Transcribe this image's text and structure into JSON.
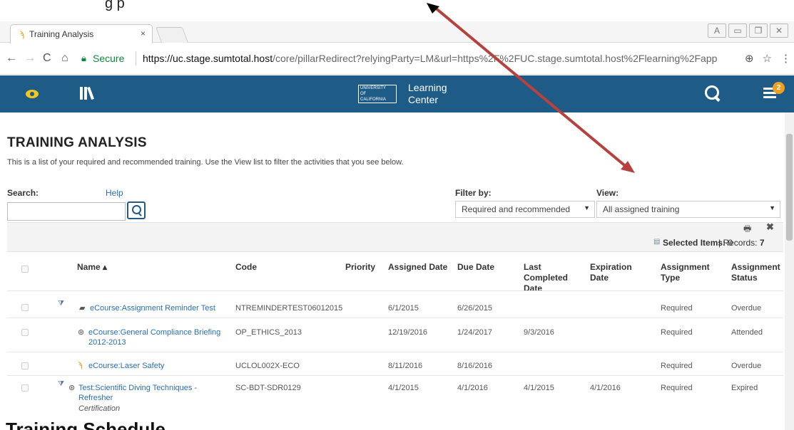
{
  "caption": {
    "text": "g                                                                                             p"
  },
  "browser": {
    "tab_title": "Training Analysis",
    "tab_close": "×",
    "secure_label": "Secure",
    "url_host": "https://uc.stage.sumtotal.host",
    "url_path": "/core/pillarRedirect?relyingParty=LM&url=https%2F%2FUC.stage.sumtotal.host%2Flearning%2Fapp"
  },
  "header": {
    "logo_line1": "UNIVERSITY",
    "logo_line2": "OF",
    "logo_line3": "CALIFORNIA",
    "logo_title1": "Learning",
    "logo_title2": "Center",
    "notification_count": "2"
  },
  "page": {
    "title": "TRAINING ANALYSIS",
    "intro": "This is a list of your required and recommended training. Use the View list to filter the activities that you see below.",
    "search_label": "Search:",
    "help_label": "Help",
    "search_value": "",
    "filter_label": "Filter by:",
    "filter_value": "Required and recommended",
    "view_label": "View:",
    "view_value": "All assigned training",
    "selected_label": "Selected Items:",
    "selected_count": "0",
    "records_label": "| Records:",
    "records_count": "7"
  },
  "table": {
    "headers": {
      "name": "Name ▴",
      "code": "Code",
      "priority": "Priority",
      "assigned": "Assigned Date",
      "due": "Due Date",
      "last_completed": "Last Completed Date",
      "expiration": "Expiration Date",
      "assignment_type": "Assignment Type",
      "assignment_status": "Assignment Status"
    },
    "rows": [
      {
        "name": "eCourse:Assignment Reminder Test",
        "code": "NTREMINDERTEST06012015",
        "assigned": "6/1/2015",
        "due": "6/26/2015",
        "last_completed": "",
        "expiration": "",
        "type": "Required",
        "status": "Overdue"
      },
      {
        "name": "eCourse:General Compliance Briefing 2012-2013",
        "code": "OP_ETHICS_2013",
        "assigned": "12/19/2016",
        "due": "1/24/2017",
        "last_completed": "9/3/2016",
        "expiration": "",
        "type": "Required",
        "status": "Attended"
      },
      {
        "name": "eCourse:Laser Safety",
        "code": "UCLOL002X-ECO",
        "assigned": "8/11/2016",
        "due": "8/16/2016",
        "last_completed": "",
        "expiration": "",
        "type": "Required",
        "status": "Overdue"
      },
      {
        "name": "Test:Scientific Diving Techniques - Refresher",
        "sub": "Certification",
        "code": "SC-BDT-SDR0129",
        "assigned": "4/1/2015",
        "due": "4/1/2016",
        "last_completed": "4/1/2015",
        "expiration": "4/1/2016",
        "type": "Required",
        "status": "Expired"
      }
    ]
  },
  "footer": {
    "heading": "Training Schedule"
  },
  "colors": {
    "header_bg": "#1e5b86",
    "link": "#2a6fb0",
    "arrow": "#b5423e",
    "badge": "#f0a020"
  },
  "icons": [
    "eye-icon",
    "books-icon",
    "search-icon",
    "list-icon",
    "print-icon",
    "close-icon",
    "flag-icon",
    "course-icon",
    "globe-icon",
    "laser-icon"
  ]
}
